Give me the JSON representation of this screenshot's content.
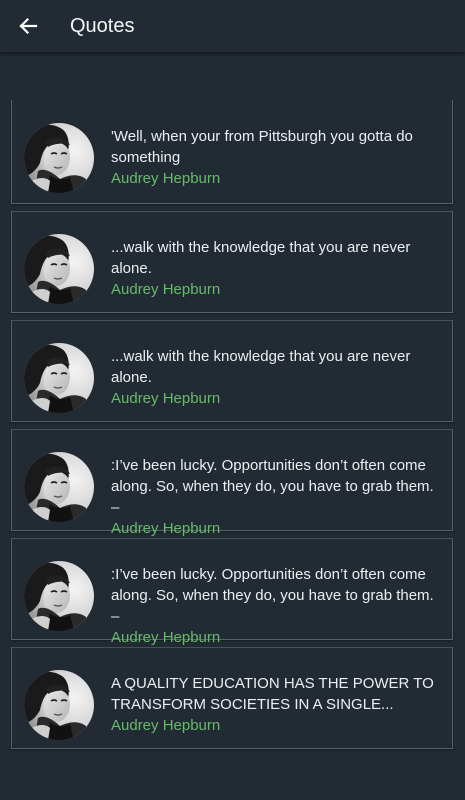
{
  "appbar": {
    "title": "Quotes",
    "back_icon": "arrow-back-icon"
  },
  "colors": {
    "background": "#222b33",
    "text": "#eceff1",
    "author": "#66bb6a",
    "card_border": "#56606a"
  },
  "quotes": [
    {
      "text": "'Well, when your from Pittsburgh you gotta do\nsomething",
      "author": "Audrey Hepburn",
      "avatar_icon": "author-avatar"
    },
    {
      "text": "...walk with the knowledge that you are never\nalone.",
      "author": "Audrey Hepburn",
      "avatar_icon": "author-avatar"
    },
    {
      "text": "...walk with the knowledge that you are never\nalone.",
      "author": "Audrey Hepburn",
      "avatar_icon": "author-avatar"
    },
    {
      "text": ":I’ve been lucky. Opportunities don’t often come\nalong. So, when they do, you have to grab them. –",
      "author": "Audrey Hepburn",
      "avatar_icon": "author-avatar"
    },
    {
      "text": ":I’ve been lucky. Opportunities don’t often come\nalong. So, when they do, you have to grab them. –",
      "author": "Audrey Hepburn",
      "avatar_icon": "author-avatar"
    },
    {
      "text": "A QUALITY EDUCATION HAS THE POWER TO\nTRANSFORM SOCIETIES IN A SINGLE...",
      "author": "Audrey Hepburn",
      "avatar_icon": "author-avatar"
    }
  ]
}
